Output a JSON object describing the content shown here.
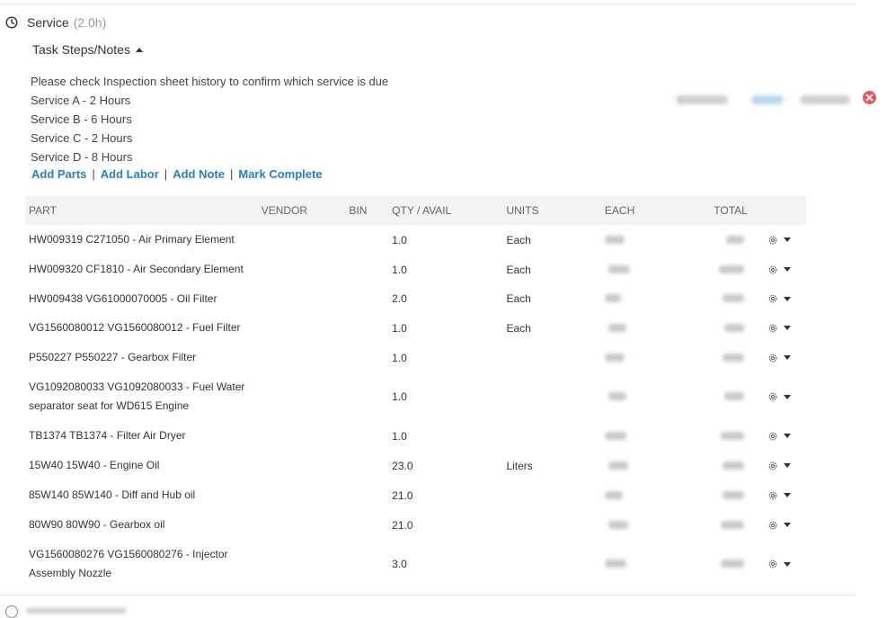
{
  "service": {
    "title": "Service",
    "hours": "(2.0h)"
  },
  "task_steps": {
    "label": "Task Steps/Notes"
  },
  "notes": [
    "Please check Inspection sheet history to confirm which service is due",
    "Service A - 2 Hours",
    "Service B - 6 Hours",
    "Service C - 2 Hours",
    "Service D - 8 Hours"
  ],
  "actions": {
    "add_parts": "Add Parts",
    "add_labor": "Add Labor",
    "add_note": "Add Note",
    "mark_complete": "Mark Complete",
    "separator": "|"
  },
  "table": {
    "headers": {
      "part": "PART",
      "vendor": "VENDOR",
      "bin": "BIN",
      "qty": "QTY / AVAIL",
      "units": "UNITS",
      "each": "EACH",
      "total": "TOTAL"
    },
    "rows": [
      {
        "part": "HW009319 C271050 - Air Primary Element",
        "qty": "1.0",
        "units": "Each"
      },
      {
        "part": "HW009320 CF1810 - Air Secondary Element",
        "qty": "1.0",
        "units": "Each"
      },
      {
        "part": "HW009438 VG61000070005 - Oil Filter",
        "qty": "2.0",
        "units": "Each"
      },
      {
        "part": "VG1560080012 VG1560080012 - Fuel Filter",
        "qty": "1.0",
        "units": "Each"
      },
      {
        "part": "P550227 P550227 - Gearbox Filter",
        "qty": "1.0",
        "units": ""
      },
      {
        "part": "VG1092080033 VG1092080033 - Fuel Water separator seat for WD615 Engine",
        "qty": "1.0",
        "units": ""
      },
      {
        "part": "TB1374 TB1374 - Filter Air Dryer",
        "qty": "1.0",
        "units": ""
      },
      {
        "part": "15W40 15W40 - Engine Oil",
        "qty": "23.0",
        "units": "Liters"
      },
      {
        "part": "85W140 85W140 - Diff and Hub oil",
        "qty": "21.0",
        "units": ""
      },
      {
        "part": "80W90 80W90 - Gearbox oil",
        "qty": "21.0",
        "units": ""
      },
      {
        "part": "VG1560080276 VG1560080276 - Injector Assembly Nozzle",
        "qty": "3.0",
        "units": ""
      }
    ]
  },
  "icons": {
    "clock": "clock-icon",
    "caret_up": "caret-up-icon",
    "gear": "gear-icon",
    "caret_down": "chevron-down-icon",
    "close": "close-icon"
  },
  "colors": {
    "link": "#2a7fc6",
    "close": "#e8585d",
    "header_bg": "#f3f3f3"
  }
}
